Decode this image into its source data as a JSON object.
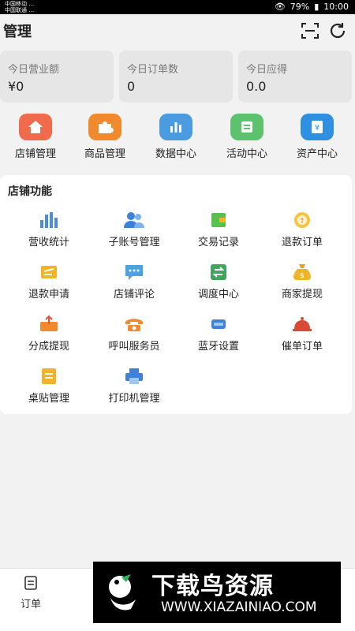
{
  "status_bar": {
    "carrier_1": "中国移动 …",
    "carrier_2": "中国联通 …",
    "battery": "79%",
    "time": "10:00"
  },
  "header": {
    "title": "管理"
  },
  "stats": [
    {
      "label": "今日营业额",
      "value": "¥0"
    },
    {
      "label": "今日订单数",
      "value": "0"
    },
    {
      "label": "今日应得",
      "value": "0.0"
    }
  ],
  "quick_links": [
    {
      "label": "店铺管理",
      "icon": "home-icon",
      "color": "#f06a4c"
    },
    {
      "label": "商品管理",
      "icon": "puzzle-icon",
      "color": "#f08a2c"
    },
    {
      "label": "数据中心",
      "icon": "bar-chart-icon",
      "color": "#4a9be0"
    },
    {
      "label": "活动中心",
      "icon": "activity-icon",
      "color": "#5cc26e"
    },
    {
      "label": "资产中心",
      "icon": "wallet-icon",
      "color": "#2f8fe0"
    }
  ],
  "functions": {
    "title": "店铺功能",
    "items": [
      {
        "label": "营收统计",
        "icon": "revenue-chart-icon"
      },
      {
        "label": "子账号管理",
        "icon": "users-icon"
      },
      {
        "label": "交易记录",
        "icon": "transaction-icon"
      },
      {
        "label": "退款订单",
        "icon": "refund-order-icon"
      },
      {
        "label": "退款申请",
        "icon": "refund-apply-icon"
      },
      {
        "label": "店铺评论",
        "icon": "comment-icon"
      },
      {
        "label": "调度中心",
        "icon": "dispatch-icon"
      },
      {
        "label": "商家提现",
        "icon": "money-bag-icon"
      },
      {
        "label": "分成提现",
        "icon": "share-withdraw-icon"
      },
      {
        "label": "呼叫服务员",
        "icon": "phone-icon"
      },
      {
        "label": "蓝牙设置",
        "icon": "bluetooth-icon"
      },
      {
        "label": "催单订单",
        "icon": "bell-icon"
      },
      {
        "label": "桌贴管理",
        "icon": "table-sticker-icon"
      },
      {
        "label": "打印机管理",
        "icon": "printer-icon"
      }
    ]
  },
  "tabbar": {
    "order_label": "订单"
  },
  "watermark": {
    "title": "下载鸟资源",
    "url": "WWW.XIAZAINIAO.COM"
  }
}
